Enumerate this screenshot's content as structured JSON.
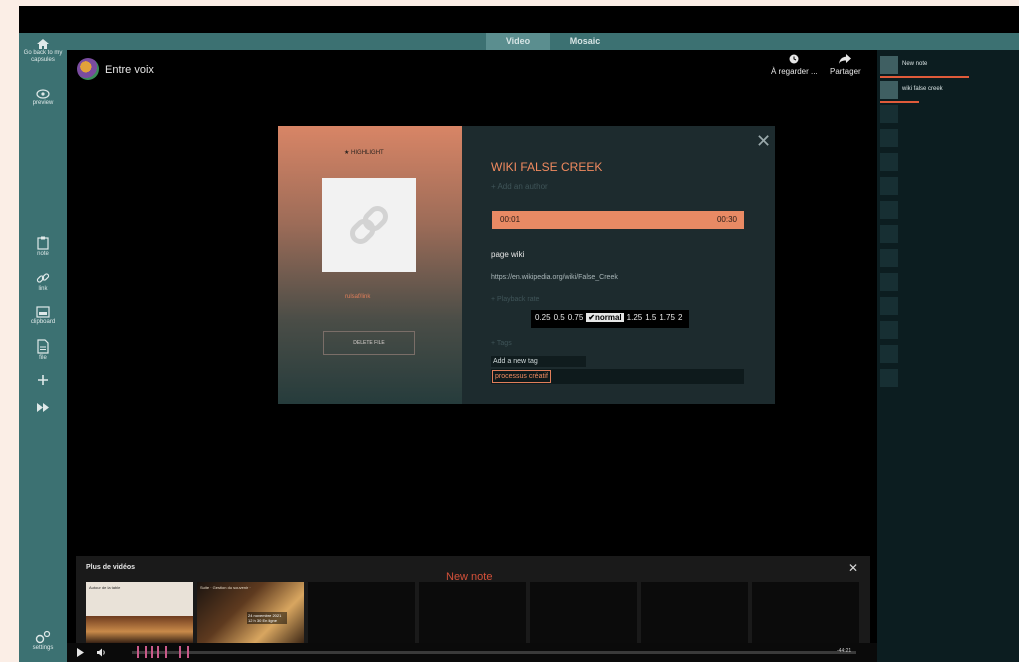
{
  "tabs": {
    "video": "Video",
    "mosaic": "Mosaic"
  },
  "sidebar": {
    "back_label": "Go back to my capsules",
    "preview_label": "preview",
    "tools": [
      {
        "label": "note",
        "icon": "note-icon"
      },
      {
        "label": "link",
        "icon": "link-icon"
      },
      {
        "label": "clipboard",
        "icon": "clipboard-icon"
      },
      {
        "label": "file",
        "icon": "file-icon"
      }
    ],
    "settings_label": "settings"
  },
  "header": {
    "title": "Entre voix",
    "watch_later_label": "À regarder ...",
    "share_label": "Partager"
  },
  "notes_panel": {
    "items": [
      "New note",
      "wiki false creek"
    ]
  },
  "modal": {
    "highlight_label": "★ HIGHLIGHT",
    "file_name": "rulsaf/link",
    "delete_label": "DELETE FILE",
    "close_glyph": "✕",
    "title": "WIKI FALSE CREEK",
    "author_placeholder": "+ Add an author",
    "time_start": "00:01",
    "time_end": "00:30",
    "description": "page wiki",
    "url": "https://en.wikipedia.org/wiki/False_Creek",
    "playback_label": "+ Playback rate",
    "rates": [
      "0.25",
      "0.5",
      "0.75",
      "✔normal",
      "1.25",
      "1.5",
      "1.75",
      "2"
    ],
    "selected_rate": "✔normal",
    "tags_label": "+ Tags",
    "tag_placeholder": "Add a new tag",
    "tags": [
      "processus créatif"
    ]
  },
  "more_videos": {
    "title": "Plus de vidéos",
    "new_note_label": "New note",
    "close_glyph": "✕",
    "thumb1_text": "Autour de la table",
    "thumb2_text": "Suite · Gestion du souvenir ·",
    "thumb2_date": "24 novembre 2021 12 h 30 En ligne"
  },
  "timeline": {
    "time": "-44:21"
  },
  "colors": {
    "accent": "#e88a64",
    "sidebar": "#3c7172",
    "note_underline": "#e05b3a"
  }
}
